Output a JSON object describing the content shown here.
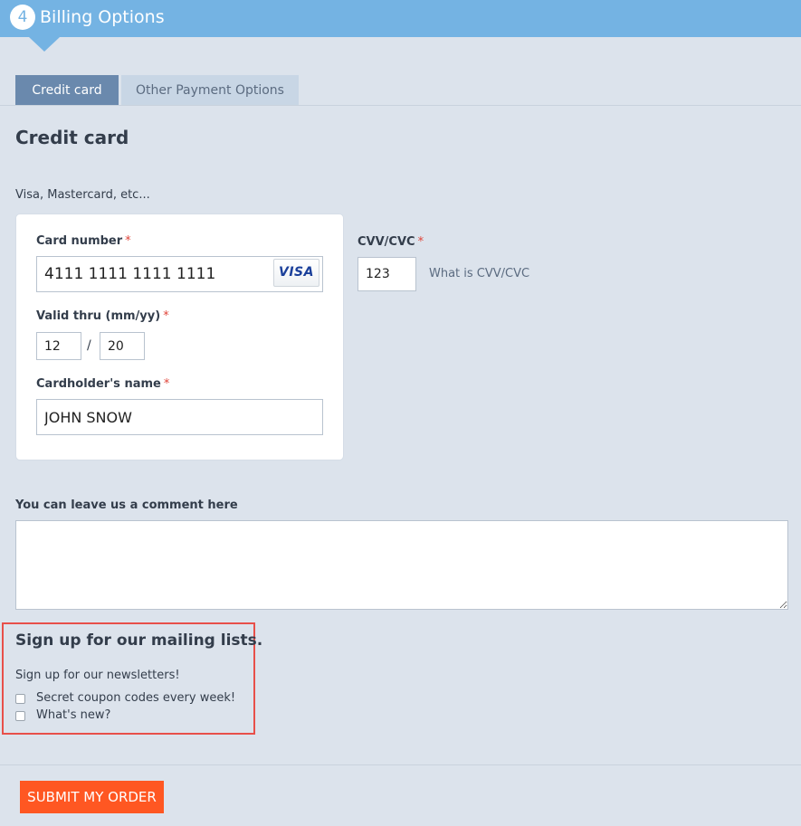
{
  "step": {
    "number": "4",
    "title": "Billing Options"
  },
  "tabs": [
    {
      "label": "Credit card",
      "active": true
    },
    {
      "label": "Other Payment Options",
      "active": false
    }
  ],
  "section_title": "Credit card",
  "cards_note": "Visa, Mastercard, etc...",
  "card_number": {
    "label": "Card number",
    "required": "*",
    "value": "4111 1111 1111 1111",
    "brand": "VISA"
  },
  "valid_thru": {
    "label": "Valid thru (mm/yy)",
    "required": "*",
    "month": "12",
    "separator": "/",
    "year": "20"
  },
  "cardholder": {
    "label": "Cardholder's name",
    "required": "*",
    "value": "JOHN SNOW"
  },
  "cvv": {
    "label": "CVV/CVC",
    "required": "*",
    "value": "123",
    "help_link": "What is CVV/CVC"
  },
  "comment": {
    "label": "You can leave us a comment here",
    "value": ""
  },
  "mailing": {
    "title": "Sign up for our mailing lists.",
    "subtitle": "Sign up for our newsletters!",
    "options": [
      {
        "label": "Secret coupon codes every week!",
        "checked": false
      },
      {
        "label": "What's new?",
        "checked": false
      }
    ]
  },
  "submit_label": "SUBMIT MY ORDER",
  "colors": {
    "header": "#74b3e3",
    "active_tab": "#6a89ad",
    "submit": "#ff5722",
    "highlight_border": "#e8504a"
  }
}
